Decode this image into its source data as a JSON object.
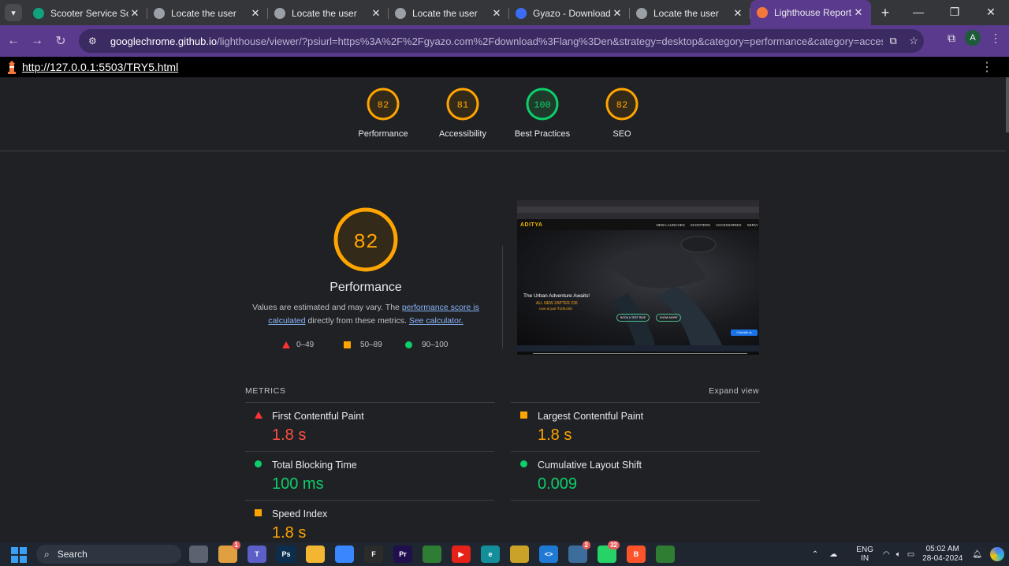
{
  "browser": {
    "tabs": [
      {
        "title": "Scooter Service Soluti",
        "icon": "openai-icon",
        "color": "#10a37f"
      },
      {
        "title": "Locate the user",
        "icon": "globe-icon",
        "color": "#9aa0a6"
      },
      {
        "title": "Locate the user",
        "icon": "globe-icon",
        "color": "#9aa0a6"
      },
      {
        "title": "Locate the user",
        "icon": "globe-icon",
        "color": "#9aa0a6"
      },
      {
        "title": "Gyazo - Download",
        "icon": "gyazo-icon",
        "color": "#3b6cf6"
      },
      {
        "title": "Locate the user",
        "icon": "globe-icon",
        "color": "#9aa0a6"
      },
      {
        "title": "Lighthouse Report V",
        "icon": "lighthouse-icon",
        "color": "#f4783c",
        "active": true
      }
    ],
    "url_host": "googlechrome.github.io",
    "url_path": "/lighthouse/viewer/?psiurl=https%3A%2F%2Fgyazo.com%2Fdownload%3Flang%3Den&strategy=desktop&category=performance&category=accessibility&categor...",
    "profile_initial": "A",
    "accent_color": "#5a3a8c"
  },
  "report": {
    "page_url": "http://127.0.0.1:5503/TRY5.html",
    "categories": [
      {
        "label": "Performance",
        "score": "82",
        "status": "average",
        "color": "#ffa400"
      },
      {
        "label": "Accessibility",
        "score": "81",
        "status": "average",
        "color": "#ffa400"
      },
      {
        "label": "Best Practices",
        "score": "100",
        "status": "pass",
        "color": "#0cce6b"
      },
      {
        "label": "SEO",
        "score": "82",
        "status": "average",
        "color": "#ffa400"
      }
    ],
    "main_gauge": {
      "score": "82",
      "title": "Performance"
    },
    "description": {
      "text1": "Values are estimated and may vary. The ",
      "link1": "performance score is calculated",
      "text2": " directly from these metrics. ",
      "link2": "See calculator."
    },
    "legend": [
      {
        "range": "0–49",
        "icon": "fail-triangle-icon"
      },
      {
        "range": "50–89",
        "icon": "average-square-icon"
      },
      {
        "range": "90–100",
        "icon": "pass-circle-icon"
      }
    ],
    "screenshot": {
      "brand": "ADITYA",
      "nav_links": [
        "NEW LAUNCHES",
        "SCOOTERS",
        "ACCESSORIES",
        "SERVI"
      ],
      "headline": "The Urban Adventure Awaits!",
      "subline": "ALL NEW ZAPTER 236",
      "price": "now at just ₹109,000",
      "btn1": "BOOK A TEST RIDE",
      "btn2": "KNOW MORE",
      "chat": "Chat with us"
    },
    "metrics_label": "METRICS",
    "expand_label": "Expand view",
    "metrics": [
      {
        "name": "First Contentful Paint",
        "value": "1.8 s",
        "status": "fail",
        "color": "#ff4e42"
      },
      {
        "name": "Largest Contentful Paint",
        "value": "1.8 s",
        "status": "average",
        "color": "#ffa400"
      },
      {
        "name": "Total Blocking Time",
        "value": "100 ms",
        "status": "pass",
        "color": "#0cce6b"
      },
      {
        "name": "Cumulative Layout Shift",
        "value": "0.009",
        "status": "pass",
        "color": "#0cce6b"
      },
      {
        "name": "Speed Index",
        "value": "1.8 s",
        "status": "average",
        "color": "#ffa400"
      }
    ]
  },
  "taskbar": {
    "search_label": "Search",
    "lang1": "ENG",
    "lang2": "IN",
    "time": "05:02 AM",
    "date": "28-04-2024",
    "apps": [
      {
        "name": "task-view-icon",
        "color": "#5c6370",
        "glyph": ""
      },
      {
        "name": "widget-icon",
        "color": "#e0a040",
        "glyph": "",
        "badge": "1"
      },
      {
        "name": "teams-icon",
        "color": "#5b5fc7",
        "glyph": "T"
      },
      {
        "name": "photoshop-icon",
        "color": "#0b2e4f",
        "glyph": "Ps"
      },
      {
        "name": "file-explorer-icon",
        "color": "#f2b632",
        "glyph": ""
      },
      {
        "name": "microsoft-store-icon",
        "color": "#3a86ff",
        "glyph": ""
      },
      {
        "name": "figma-icon",
        "color": "#2b2b2b",
        "glyph": "F"
      },
      {
        "name": "premiere-icon",
        "color": "#1f0f4d",
        "glyph": "Pr"
      },
      {
        "name": "chrome-icon",
        "color": "#2e7d32",
        "glyph": ""
      },
      {
        "name": "youtube-icon",
        "color": "#e62117",
        "glyph": "▶"
      },
      {
        "name": "edge-icon",
        "color": "#138f9c",
        "glyph": "e"
      },
      {
        "name": "chrome-canary-icon",
        "color": "#c9a227",
        "glyph": ""
      },
      {
        "name": "vscode-icon",
        "color": "#1f7ad6",
        "glyph": "<>"
      },
      {
        "name": "app-icon",
        "color": "#3c6d9c",
        "glyph": "",
        "badge": "2"
      },
      {
        "name": "whatsapp-icon",
        "color": "#25d366",
        "glyph": "",
        "badge": "32"
      },
      {
        "name": "brave-icon",
        "color": "#fb542b",
        "glyph": "B"
      },
      {
        "name": "chrome-active-icon",
        "color": "#2e7d32",
        "glyph": ""
      }
    ]
  }
}
